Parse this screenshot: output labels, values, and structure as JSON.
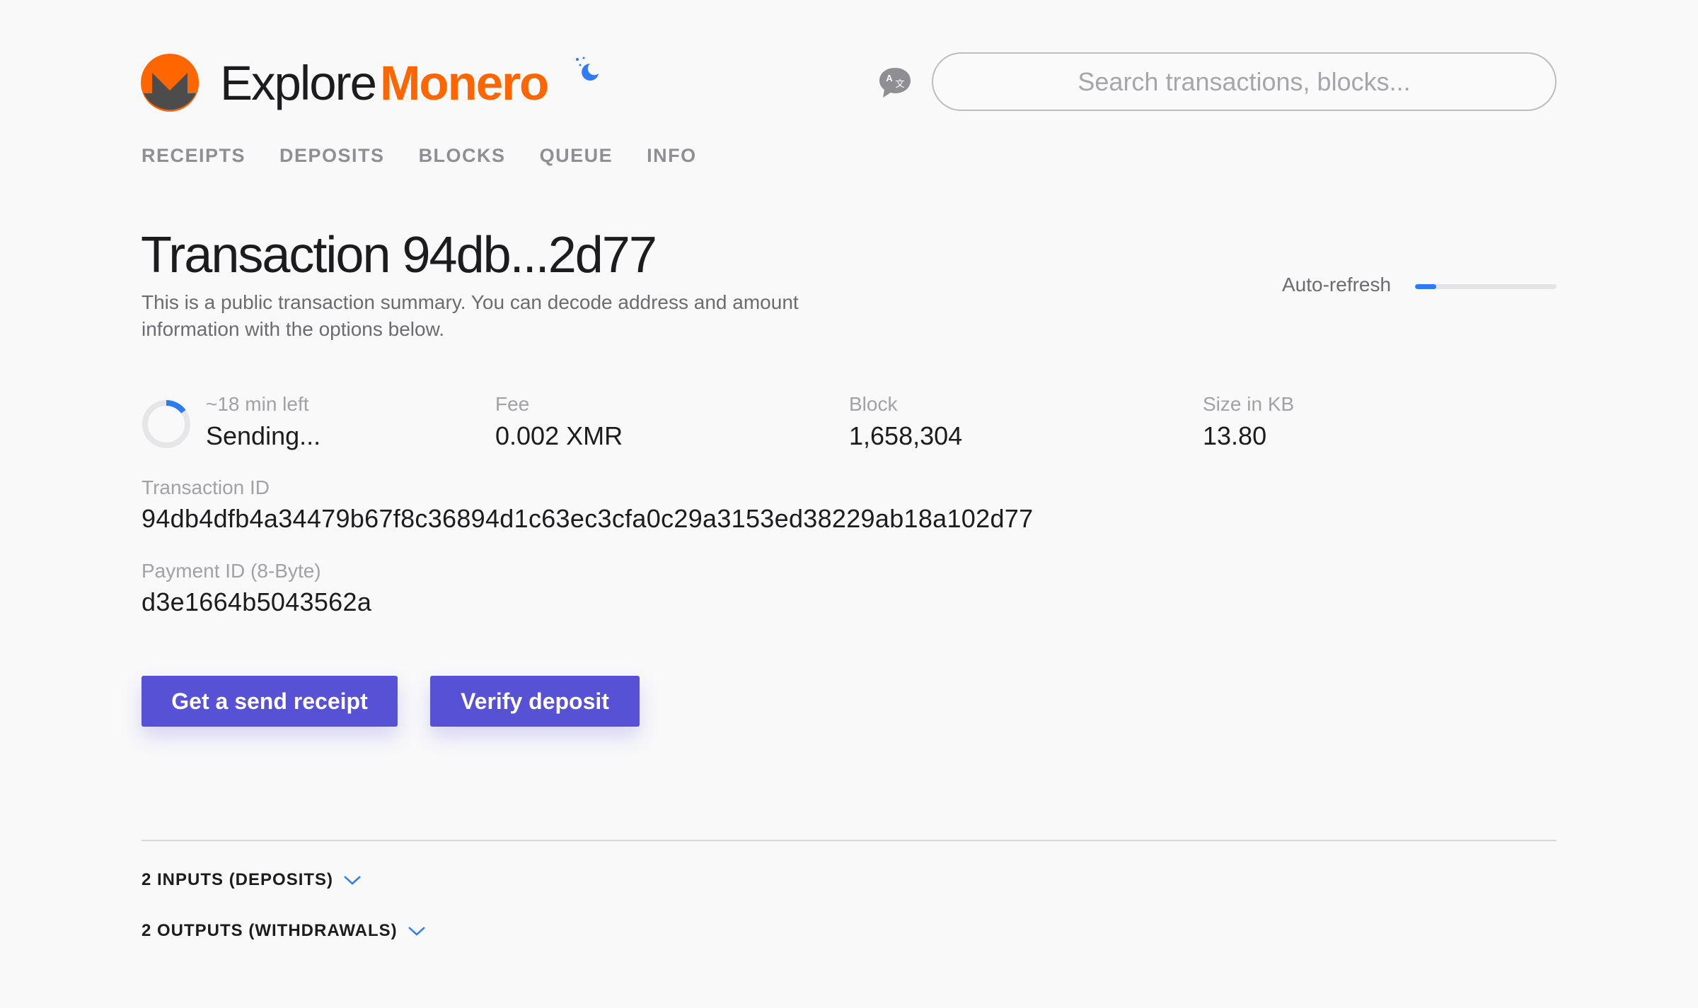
{
  "header": {
    "logo_explore": "Explore",
    "logo_monero": "Monero",
    "search_placeholder": "Search transactions, blocks..."
  },
  "nav": {
    "items": [
      "RECEIPTS",
      "DEPOSITS",
      "BLOCKS",
      "QUEUE",
      "INFO"
    ]
  },
  "transaction": {
    "title": "Transaction 94db...2d77",
    "description": "This is a public transaction summary. You can decode address and amount information with the options below.",
    "auto_refresh_label": "Auto-refresh",
    "auto_refresh_progress": 0.15,
    "status_time": "~18 min left",
    "status": "Sending...",
    "status_progress": 0.15,
    "fee_label": "Fee",
    "fee": "0.002 XMR",
    "block_label": "Block",
    "block": "1,658,304",
    "size_label": "Size in KB",
    "size": "13.80",
    "id_label": "Transaction ID",
    "id": "94db4dfb4a34479b67f8c36894d1c63ec3cfa0c29a3153ed38229ab18a102d77",
    "payment_id_label": "Payment ID (8-Byte)",
    "payment_id": "d3e1664b5043562a"
  },
  "actions": {
    "send_receipt": "Get a send receipt",
    "verify_deposit": "Verify deposit"
  },
  "sections": {
    "inputs": "2 INPUTS (DEPOSITS)",
    "outputs": "2 OUTPUTS (WITHDRAWALS)"
  },
  "colors": {
    "brand_orange": "#ff6600",
    "logo_dark": "#4c4c4c",
    "accent_blue": "#2f7bf5",
    "button_purple": "#5751d6"
  },
  "icons": {
    "logo": "monero-logo-icon",
    "theme": "moon-icon",
    "language": "translate-icon",
    "status": "spinner-icon",
    "expand": "chevron-down-icon"
  }
}
